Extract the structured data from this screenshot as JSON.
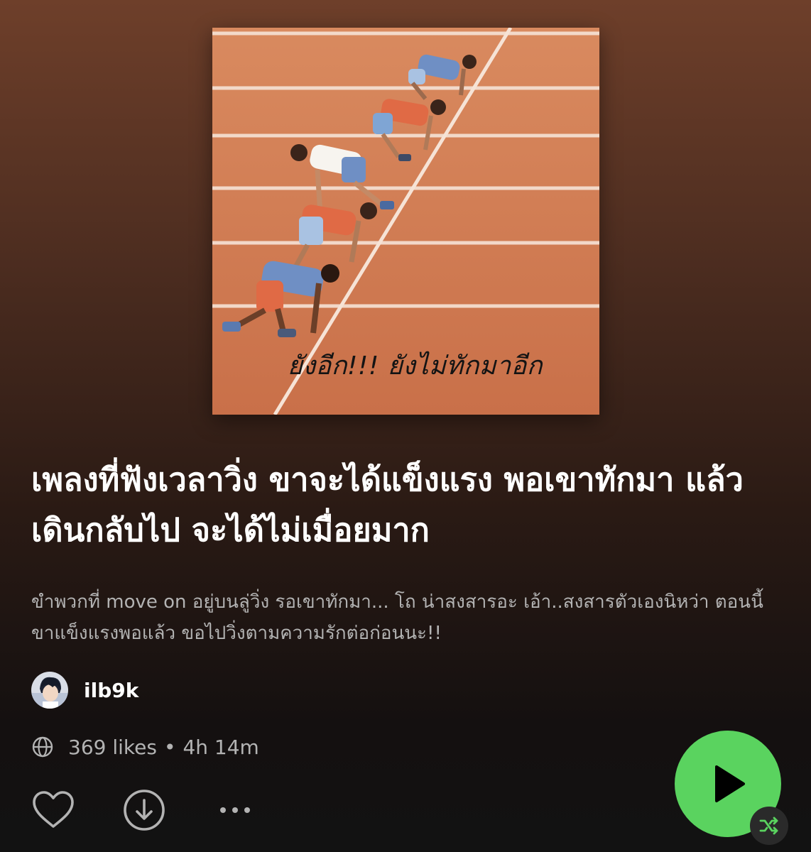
{
  "cover": {
    "caption": "ยังอีก!!! ยังไม่ทักมาอีก"
  },
  "playlist": {
    "title": "เพลงที่ฟังเวลาวิ่ง ขาจะได้แข็งแรง พอเขาทักมา แล้วเดินกลับไป จะได้ไม่เมื่อยมาก",
    "description": "ขำพวกที่ move on อยู่บนลู่วิ่ง รอเขาทักมา... โถ น่าสงสารอะ เอ้า..สงสารตัวเองนิหว่า ตอนนี้ขาแข็งแรงพอแล้ว ขอไปวิ่งตามความรักต่อก่อนนะ!!"
  },
  "owner": {
    "name": "ilb9k"
  },
  "meta": {
    "likes": "369 likes",
    "separator": "•",
    "duration": "4h 14m"
  },
  "icons": {
    "globe": "globe-icon",
    "like": "heart-outline-icon",
    "download": "download-icon",
    "more": "more-options-icon",
    "play": "play-icon",
    "shuffle": "shuffle-icon"
  },
  "colors": {
    "accent_green": "#5ad35f",
    "track_orange": "#d07a52",
    "secondary_text": "#b3b3b3"
  }
}
